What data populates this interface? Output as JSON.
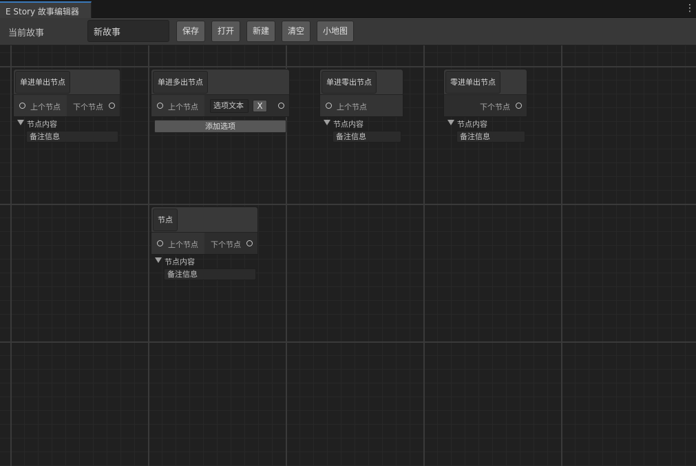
{
  "window": {
    "tab_title": "E Story 故事编辑器",
    "menu_icon": "kebab-menu-icon",
    "accent": "#3a79bb"
  },
  "toolbar": {
    "story_label": "当前故事",
    "story_name": "新故事",
    "buttons": {
      "save": "保存",
      "open": "打开",
      "new": "新建",
      "clear": "清空",
      "minimap": "小地图"
    }
  },
  "nodes": {
    "single_in_single_out": {
      "title": "单进单出节点",
      "input_port": "上个节点",
      "output_port": "下个节点",
      "content_label": "节点内容",
      "note": "备注信息"
    },
    "single_in_multi_out": {
      "title": "单进多出节点",
      "input_port": "上个节点",
      "option_text": "选项文本",
      "remove_label": "X",
      "add_option": "添加选项"
    },
    "single_in_zero_out": {
      "title": "单进零出节点",
      "input_port": "上个节点",
      "content_label": "节点内容",
      "note": "备注信息"
    },
    "zero_in_single_out": {
      "title": "零进单出节点",
      "output_port": "下个节点",
      "content_label": "节点内容",
      "note": "备注信息"
    },
    "generic": {
      "title": "节点",
      "input_port": "上个节点",
      "output_port": "下个节点",
      "content_label": "节点内容",
      "note": "备注信息"
    }
  }
}
